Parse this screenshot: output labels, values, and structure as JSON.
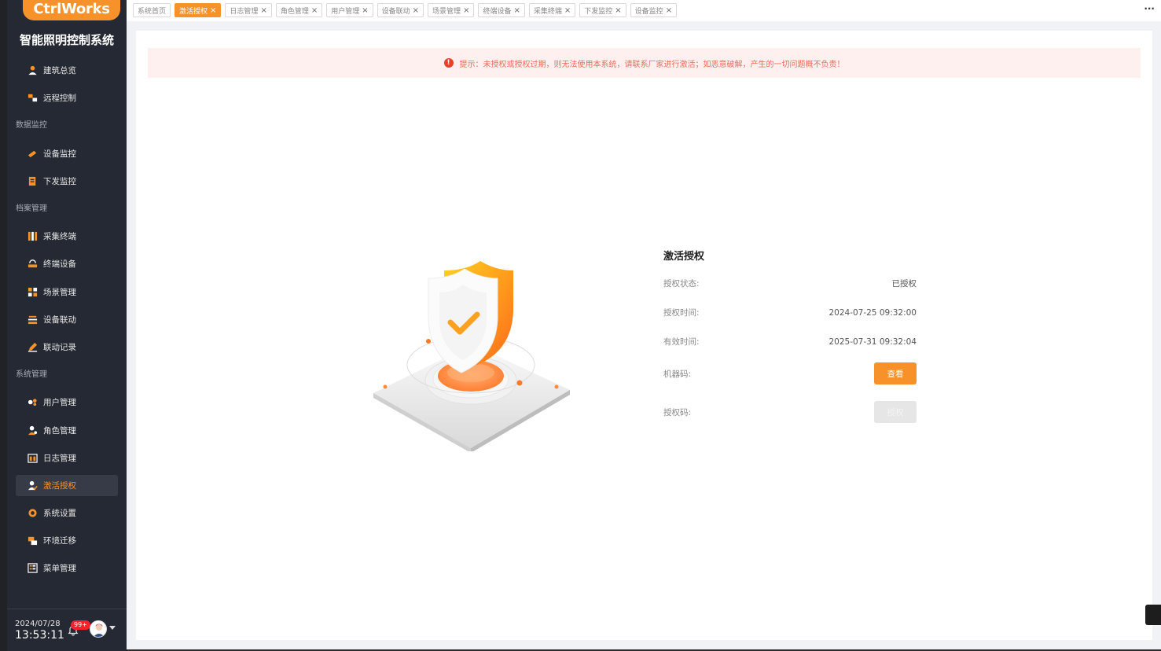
{
  "app": {
    "logo_text": "CtrlWorks",
    "system_title": "智能照明控制系统",
    "accent_color": "#f7922b"
  },
  "sidebar": {
    "items": [
      {
        "type": "item",
        "label": "建筑总览",
        "icon": "person-icon"
      },
      {
        "type": "item",
        "label": "远程控制",
        "icon": "remote-control-icon"
      },
      {
        "type": "group",
        "label": "数据监控"
      },
      {
        "type": "item",
        "label": "设备监控",
        "icon": "device-monitor-icon"
      },
      {
        "type": "item",
        "label": "下发监控",
        "icon": "dispatch-icon"
      },
      {
        "type": "group",
        "label": "档案管理"
      },
      {
        "type": "item",
        "label": "采集终端",
        "icon": "collector-icon"
      },
      {
        "type": "item",
        "label": "终端设备",
        "icon": "terminal-icon"
      },
      {
        "type": "item",
        "label": "场景管理",
        "icon": "scene-icon"
      },
      {
        "type": "item",
        "label": "设备联动",
        "icon": "linkage-icon"
      },
      {
        "type": "item",
        "label": "联动记录",
        "icon": "record-icon"
      },
      {
        "type": "group",
        "label": "系统管理"
      },
      {
        "type": "item",
        "label": "用户管理",
        "icon": "users-icon"
      },
      {
        "type": "item",
        "label": "角色管理",
        "icon": "role-icon"
      },
      {
        "type": "item",
        "label": "日志管理",
        "icon": "log-icon"
      },
      {
        "type": "item",
        "label": "激活授权",
        "icon": "license-icon",
        "active": true
      },
      {
        "type": "item",
        "label": "系统设置",
        "icon": "settings-icon"
      },
      {
        "type": "item",
        "label": "环境迁移",
        "icon": "migrate-icon"
      },
      {
        "type": "item",
        "label": "菜单管理",
        "icon": "menu-icon"
      }
    ],
    "footer": {
      "date": "2024/07/28",
      "time": "13:53:11",
      "notification_badge": "99+"
    }
  },
  "tabs": [
    {
      "label": "系统首页",
      "closable": false
    },
    {
      "label": "激活授权",
      "closable": true,
      "active": true
    },
    {
      "label": "日志管理",
      "closable": true
    },
    {
      "label": "角色管理",
      "closable": true
    },
    {
      "label": "用户管理",
      "closable": true
    },
    {
      "label": "设备联动",
      "closable": true
    },
    {
      "label": "场景管理",
      "closable": true
    },
    {
      "label": "终端设备",
      "closable": true
    },
    {
      "label": "采集终端",
      "closable": true
    },
    {
      "label": "下发监控",
      "closable": true
    },
    {
      "label": "设备监控",
      "closable": true
    }
  ],
  "tab_close_glyph": "×",
  "more_glyph": "···",
  "alert": {
    "text": "提示：未授权或授权过期，则无法使用本系统，请联系厂家进行激活；如恶意破解，产生的一切问题概不负责！",
    "icon_glyph": "!"
  },
  "license": {
    "title": "激活授权",
    "status_label": "授权状态:",
    "status_value": "已授权",
    "auth_time_label": "授权时间:",
    "auth_time_value": "2024-07-25 09:32:00",
    "valid_time_label": "有效时间:",
    "valid_time_value": "2025-07-31 09:32:04",
    "machine_code_label": "机器码:",
    "view_button": "查看",
    "auth_code_label": "授权码:",
    "authorize_button": "授权"
  }
}
